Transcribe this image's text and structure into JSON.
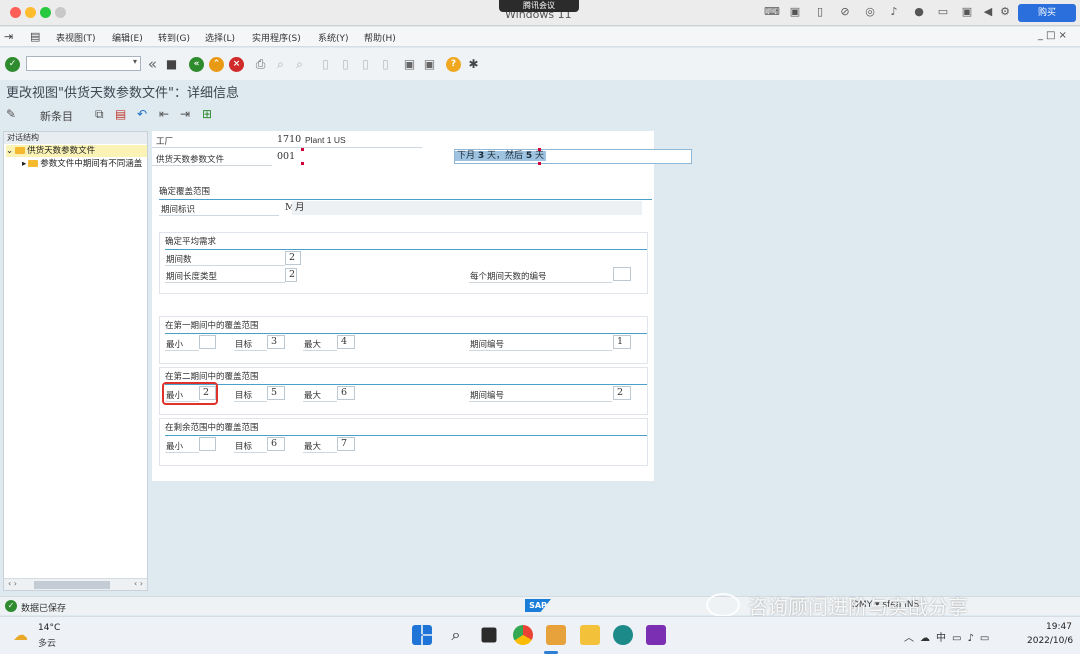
{
  "mac": {
    "meeting_label": "腾讯会议",
    "window_title": "Windows 11",
    "buy_label": "购买"
  },
  "menu": {
    "items": [
      "表视图(T)",
      "编辑(E)",
      "转到(G)",
      "选择(L)",
      "实用程序(S)",
      "系统(Y)",
      "帮助(H)"
    ]
  },
  "title": "更改视图\"供货天数参数文件\"：详细信息",
  "app_toolbar": {
    "new_entries_label": "新条目"
  },
  "nav": {
    "header": "对话结构",
    "item1": "供货天数参数文件",
    "item2": "参数文件中期间有不同涵盖"
  },
  "header_fields": {
    "plant_label": "工厂",
    "plant_value": "1710",
    "plant_name": "Plant 1 US",
    "profile_label": "供货天数参数文件",
    "profile_value": "001",
    "profile_desc_pre": "下月 ",
    "profile_desc_b1": "3",
    "profile_desc_mid": " 天，然后 ",
    "profile_desc_b2": "5",
    "profile_desc_post": " 天"
  },
  "coverage_range": {
    "heading": "确定覆盖范围",
    "period_ind_label": "期间标识",
    "period_ind_value": "M",
    "period_ind_text": "月"
  },
  "avg_requirements": {
    "heading": "确定平均需求",
    "num_periods_label": "期间数",
    "num_periods_value": "2",
    "period_len_label": "期间长度类型",
    "period_len_value": "2",
    "days_per_period_label": "每个期间天数的编号",
    "days_per_period_value": ""
  },
  "period1": {
    "heading": "在第一期间中的覆盖范围",
    "min_label": "最小",
    "min_value": "",
    "target_label": "目标",
    "target_value": "3",
    "max_label": "最大",
    "max_value": "4",
    "period_no_label": "期间编号",
    "period_no_value": "1"
  },
  "period2": {
    "heading": "在第二期间中的覆盖范围",
    "min_label": "最小",
    "min_value": "2",
    "target_label": "目标",
    "target_value": "5",
    "max_label": "最大",
    "max_value": "6",
    "period_no_label": "期间编号",
    "period_no_value": "2"
  },
  "remaining": {
    "heading": "在剩余范围中的覆盖范围",
    "min_label": "最小",
    "min_value": "",
    "target_label": "目标",
    "target_value": "6",
    "max_label": "最大",
    "max_value": "7"
  },
  "status": {
    "message": "数据已保存",
    "sap_logo": "SAP",
    "right_text": "DMY ▾ sfea INS"
  },
  "watermark": "咨询顾问进阶与实战分享",
  "taskbar": {
    "temperature": "14°C",
    "condition": "多云",
    "time": "19:47",
    "date": "2022/10/6",
    "ime": "中"
  },
  "colors": {
    "accent_blue": "#2d7fd5",
    "highlight_red": "#e0312a",
    "nav_selected": "#fbf3b6",
    "section_rule": "#4aa0c8"
  }
}
